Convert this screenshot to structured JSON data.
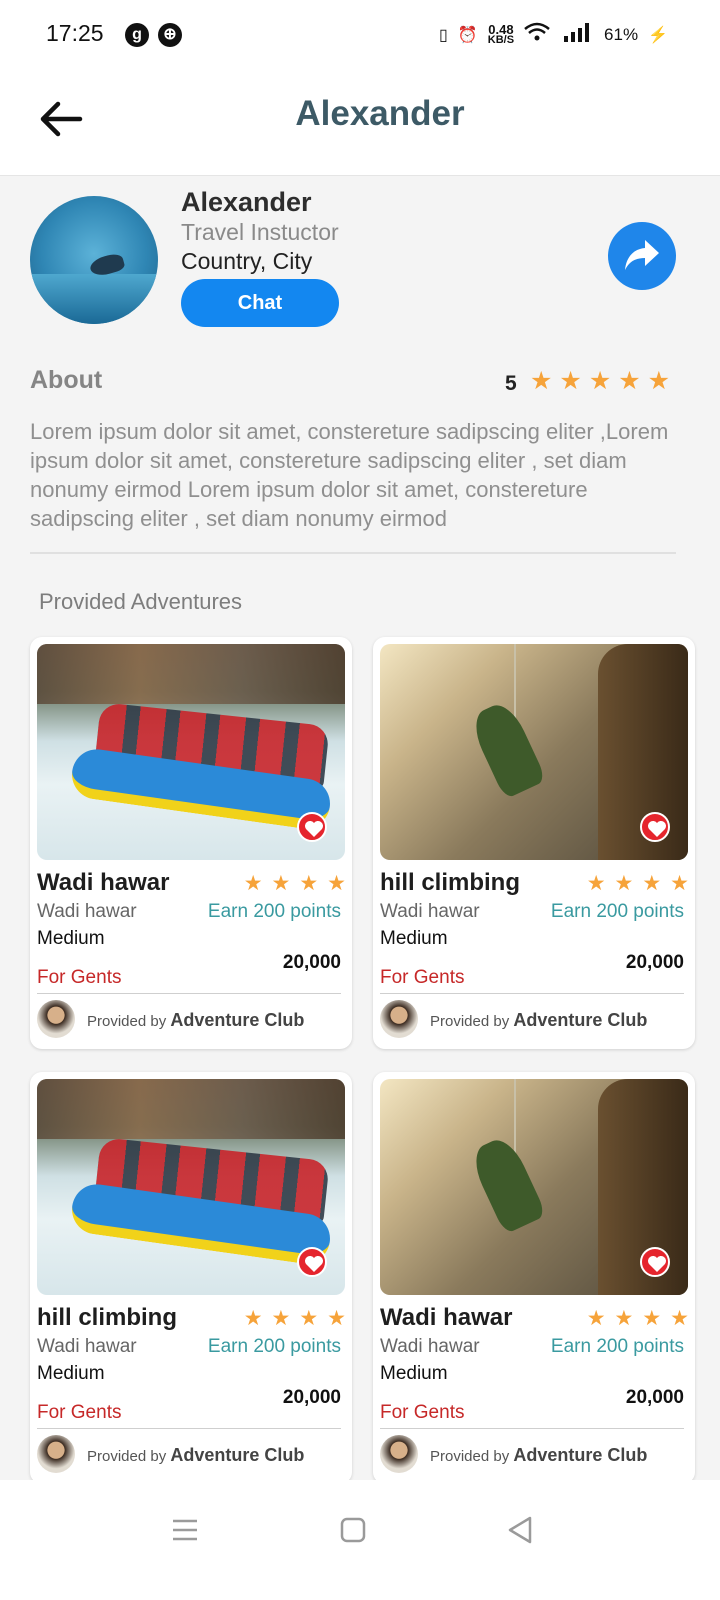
{
  "status_bar": {
    "time": "17:25",
    "app_icons": [
      "g",
      "⊕"
    ],
    "net_speed_value": "0.48",
    "net_speed_unit": "KB/S",
    "battery": "61%"
  },
  "header": {
    "title": "Alexander"
  },
  "profile": {
    "name": "Alexander",
    "role": "Travel Instuctor",
    "location": "Country, City",
    "chat_label": "Chat",
    "rating_value": "5",
    "rating_stars": "★★★★★"
  },
  "about": {
    "title": "About",
    "text": "Lorem ipsum dolor sit amet, constereture sadipscing eliter ,Lorem ipsum dolor sit amet, constereture sadipscing eliter , set diam nonumy eirmod Lorem ipsum dolor sit amet, constereture sadipscing eliter , set diam nonumy eirmod"
  },
  "section_title": "Provided Adventures",
  "cards": [
    {
      "title": "Wadi hawar",
      "stars": "★★★★",
      "location": "Wadi hawar",
      "points": "Earn 200 points",
      "level": "Medium",
      "price": "20,000",
      "gender": "For Gents",
      "provided_by": "Provided by",
      "provider": "Adventure Club"
    },
    {
      "title": "hill climbing",
      "stars": "★★★★",
      "location": "Wadi hawar",
      "points": "Earn 200 points",
      "level": "Medium",
      "price": "20,000",
      "gender": "For Gents",
      "provided_by": "Provided by",
      "provider": "Adventure Club"
    },
    {
      "title": "hill climbing",
      "stars": "★★★★",
      "location": "Wadi hawar",
      "points": "Earn 200 points",
      "level": "Medium",
      "price": "20,000",
      "gender": "For Gents",
      "provided_by": "Provided by",
      "provider": "Adventure Club"
    },
    {
      "title": "Wadi hawar",
      "stars": "★★★★",
      "location": "Wadi hawar",
      "points": "Earn 200 points",
      "level": "Medium",
      "price": "20,000",
      "gender": "For Gents",
      "provided_by": "Provided by",
      "provider": "Adventure Club"
    }
  ],
  "colors": {
    "accent": "#1387f0",
    "header_title": "#3d5a66",
    "star": "#f6a33a",
    "points": "#3a9aa0",
    "gender": "#c62828",
    "heart": "#e5252d"
  },
  "icons": [
    "back-arrow-icon",
    "share-icon",
    "heart-icon",
    "menu-icon",
    "home-square-icon",
    "back-triangle-icon"
  ]
}
